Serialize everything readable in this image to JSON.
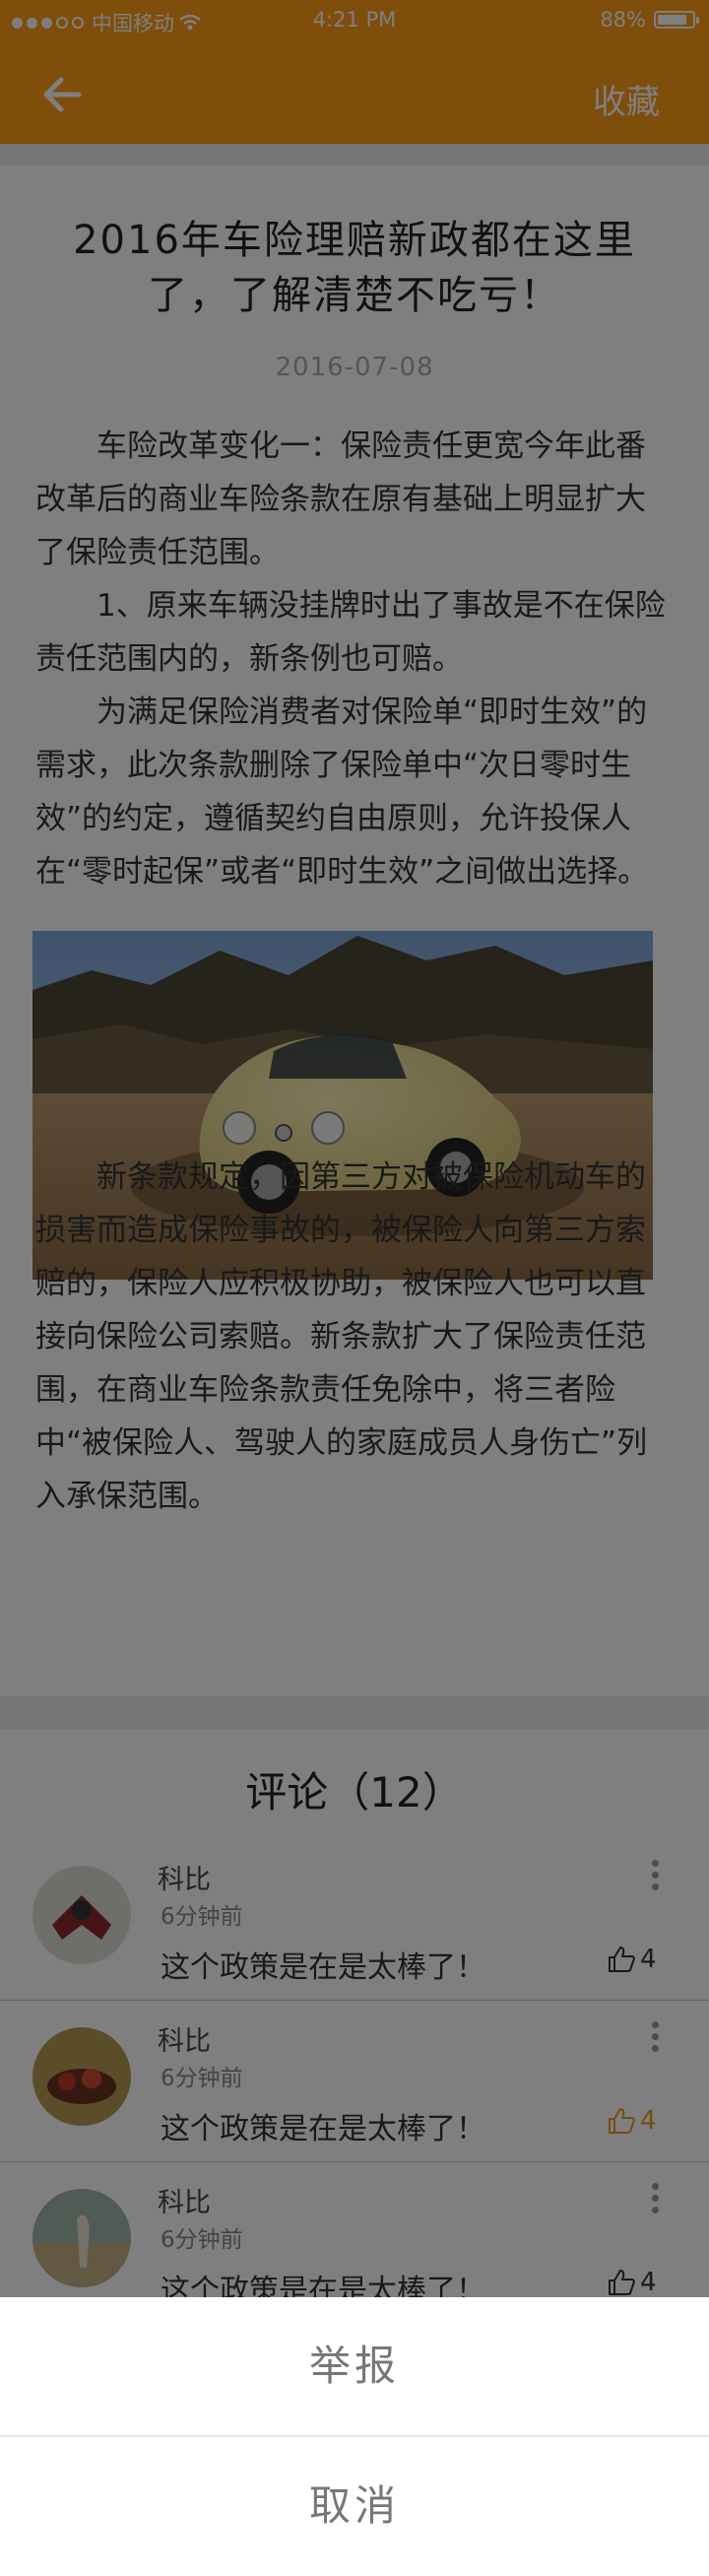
{
  "statusbar": {
    "carrier": "中国移动",
    "time": "4:21 PM",
    "battery": "88%",
    "battery_level": 0.88
  },
  "nav": {
    "back_icon": "arrow-left-icon",
    "favorite_label": "收藏"
  },
  "article": {
    "title": "2016年车险理赔新政都在这里了，了解清楚不吃亏！",
    "date": "2016-07-08",
    "paragraphs": [
      "车险改革变化一：保险责任更宽今年此番改革后的商业车险条款在原有基础上明显扩大了保险责任范围。",
      "1、原来车辆没挂牌时出了事故是不在保险责任范围内的，新条例也可赔。",
      "为满足保险消费者对保险单“即时生效”的需求，此次条款删除了保险单中“次日零时生效”的约定，遵循契约自由原则，允许投保人在“零时起保”或者“即时生效”之间做出选择。",
      "新条款规定，因第三方对被保险机动车的损害而造成保险事故的，被保险人向第三方索赔的，保险人应积极协助，被保险人也可以直接向保险公司索赔。新条款扩大了保险责任范围，在商业车险条款责任免除中，将三者险中“被保险人、驾驶人的家庭成员人身伤亡”列入承保范围。"
    ]
  },
  "comments": {
    "title": "评论（12）",
    "items": [
      {
        "name": "科比",
        "time": "6分钟前",
        "text": "这个政策是在是太棒了！",
        "likes": "4",
        "liked": false
      },
      {
        "name": "科比",
        "time": "6分钟前",
        "text": "这个政策是在是太棒了！",
        "likes": "4",
        "liked": true
      },
      {
        "name": "科比",
        "time": "6分钟前",
        "text": "这个政策是在是太棒了！",
        "likes": "4",
        "liked": false
      }
    ]
  },
  "sheet": {
    "report_label": "举报",
    "cancel_label": "取消"
  },
  "colors": {
    "brand": "#ff9d14",
    "like_active": "#e69b28"
  }
}
